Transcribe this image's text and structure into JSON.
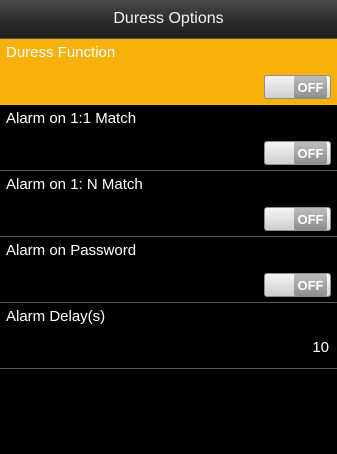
{
  "header": {
    "title": "Duress Options"
  },
  "colors": {
    "selected_row": "#f7b10a",
    "background": "#000000"
  },
  "items": [
    {
      "label": "Duress Function",
      "state": "OFF"
    },
    {
      "label": "Alarm on 1:1 Match",
      "state": "OFF"
    },
    {
      "label": "Alarm on 1: N Match",
      "state": "OFF"
    },
    {
      "label": "Alarm on Password",
      "state": "OFF"
    },
    {
      "label": "Alarm Delay(s)",
      "value": "10"
    }
  ]
}
